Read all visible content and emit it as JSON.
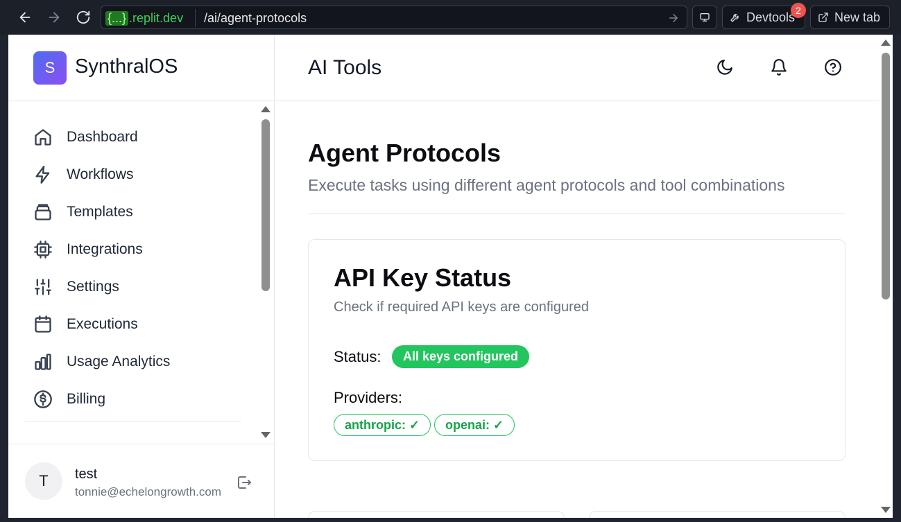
{
  "browser": {
    "url_host_brace": "{...}",
    "url_host": ".replit.dev",
    "url_path": "/ai/agent-protocols",
    "devtools_label": "Devtools",
    "devtools_badge": "2",
    "newtab_label": "New tab"
  },
  "brand": {
    "logo_letter": "S",
    "name": "SynthralOS"
  },
  "sidebar": {
    "items": [
      {
        "label": "Dashboard",
        "icon": "home-icon"
      },
      {
        "label": "Workflows",
        "icon": "lightning-icon"
      },
      {
        "label": "Templates",
        "icon": "layers-icon"
      },
      {
        "label": "Integrations",
        "icon": "chip-icon"
      },
      {
        "label": "Settings",
        "icon": "sliders-icon"
      },
      {
        "label": "Executions",
        "icon": "calendar-icon"
      },
      {
        "label": "Usage Analytics",
        "icon": "bar-chart-icon"
      },
      {
        "label": "Billing",
        "icon": "dollar-circle-icon"
      }
    ]
  },
  "user": {
    "initial": "T",
    "name": "test",
    "email": "tonnie@echelongrowth.com"
  },
  "topbar": {
    "title": "AI Tools"
  },
  "page": {
    "title": "Agent Protocols",
    "subtitle": "Execute tasks using different agent protocols and tool combinations"
  },
  "api_card": {
    "title": "API Key Status",
    "subtitle": "Check if required API keys are configured",
    "status_label": "Status:",
    "status_value": "All keys configured",
    "providers_label": "Providers:",
    "providers": [
      "anthropic: ✓",
      "openai: ✓"
    ]
  },
  "colors": {
    "accent_green": "#22c55e",
    "brand_gradient_start": "#4f6cf0",
    "brand_gradient_end": "#8b4ff0"
  }
}
